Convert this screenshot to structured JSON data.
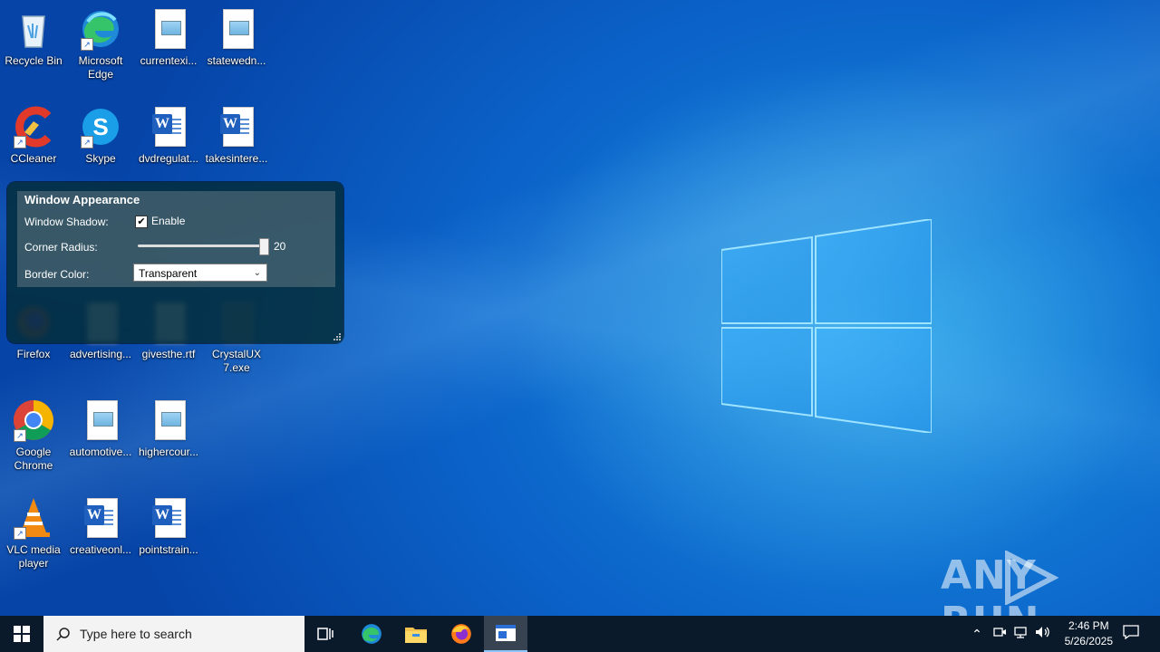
{
  "desktop": {
    "icons": [
      {
        "label": "Recycle Bin"
      },
      {
        "label": "Microsoft Edge"
      },
      {
        "label": "currentexi..."
      },
      {
        "label": "statewedn..."
      },
      {
        "label": "CCleaner"
      },
      {
        "label": "Skype"
      },
      {
        "label": "dvdregulat..."
      },
      {
        "label": "takesintere..."
      },
      {
        "label": "Firefox"
      },
      {
        "label": "advertising..."
      },
      {
        "label": "givesthe.rtf"
      },
      {
        "label": "CrystalUX 7.exe"
      },
      {
        "label": "Google Chrome"
      },
      {
        "label": "automotive..."
      },
      {
        "label": "highercour..."
      },
      {
        "label": "VLC media player"
      },
      {
        "label": "creativeonl..."
      },
      {
        "label": "pointstrain..."
      }
    ]
  },
  "panel": {
    "title": "Window Appearance",
    "shadow_label": "Window Shadow:",
    "shadow_enable_label": "Enable",
    "shadow_checked": true,
    "radius_label": "Corner Radius:",
    "radius_value": "20",
    "radius_level": 1.0,
    "border_label": "Border Color:",
    "border_value": "Transparent"
  },
  "watermark": {
    "left": "ANY",
    "right": "RUN"
  },
  "taskbar": {
    "search_placeholder": "Type here to search",
    "time": "2:46 PM",
    "date": "5/26/2025"
  },
  "colors": {
    "desktop_blue": "#0b63c9",
    "taskbar": "#0b1a2a",
    "panel_bg": "#032d3e"
  }
}
